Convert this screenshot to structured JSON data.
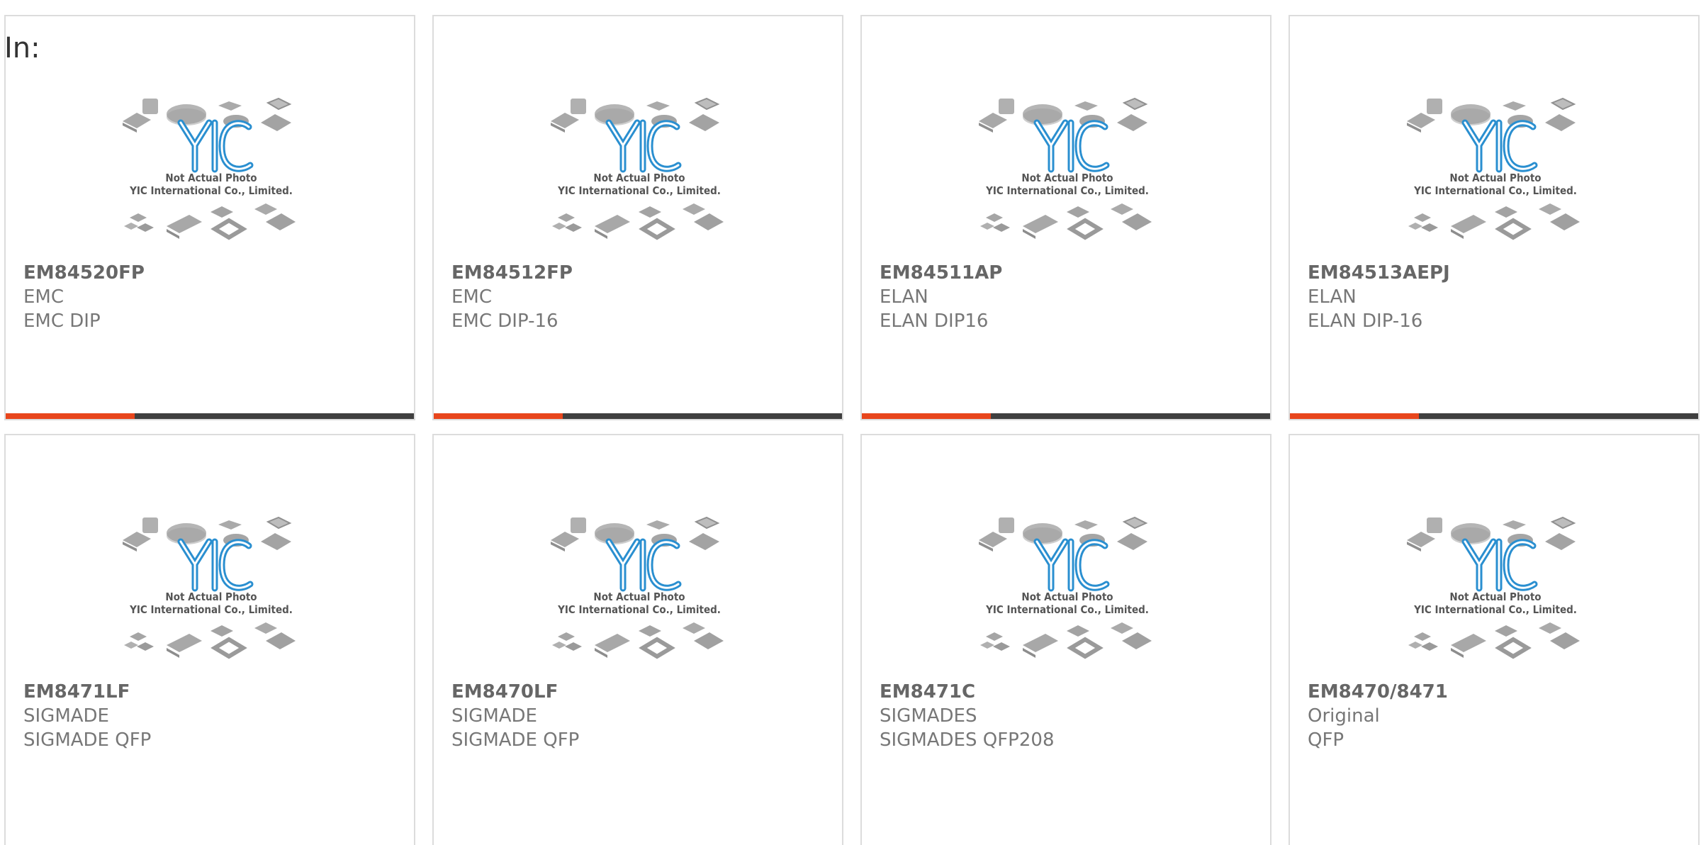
{
  "page": {
    "label": "In:"
  },
  "colors": {
    "accent": "#e8461c",
    "bar": "#3f3f3f",
    "logo_blue": "#2a8fd0",
    "card_border": "#dcdcdc"
  },
  "placeholder_image": {
    "logo_text": "YIC",
    "line1": "Not Actual Photo",
    "line2": "YIC International Co., Limited."
  },
  "products": [
    {
      "part": "EM84520FP",
      "maker": "EMC",
      "package": "EMC DIP"
    },
    {
      "part": "EM84512FP",
      "maker": "EMC",
      "package": "EMC DIP-16"
    },
    {
      "part": "EM84511AP",
      "maker": "ELAN",
      "package": "ELAN DIP16"
    },
    {
      "part": "EM84513AEPJ",
      "maker": "ELAN",
      "package": "ELAN DIP-16"
    },
    {
      "part": "EM8471LF",
      "maker": "SIGMADE",
      "package": "SIGMADE QFP"
    },
    {
      "part": "EM8470LF",
      "maker": "SIGMADE",
      "package": "SIGMADE QFP"
    },
    {
      "part": "EM8471C",
      "maker": "SIGMADES",
      "package": "SIGMADES QFP208"
    },
    {
      "part": "EM8470/8471",
      "maker": "Original",
      "package": "QFP"
    }
  ]
}
